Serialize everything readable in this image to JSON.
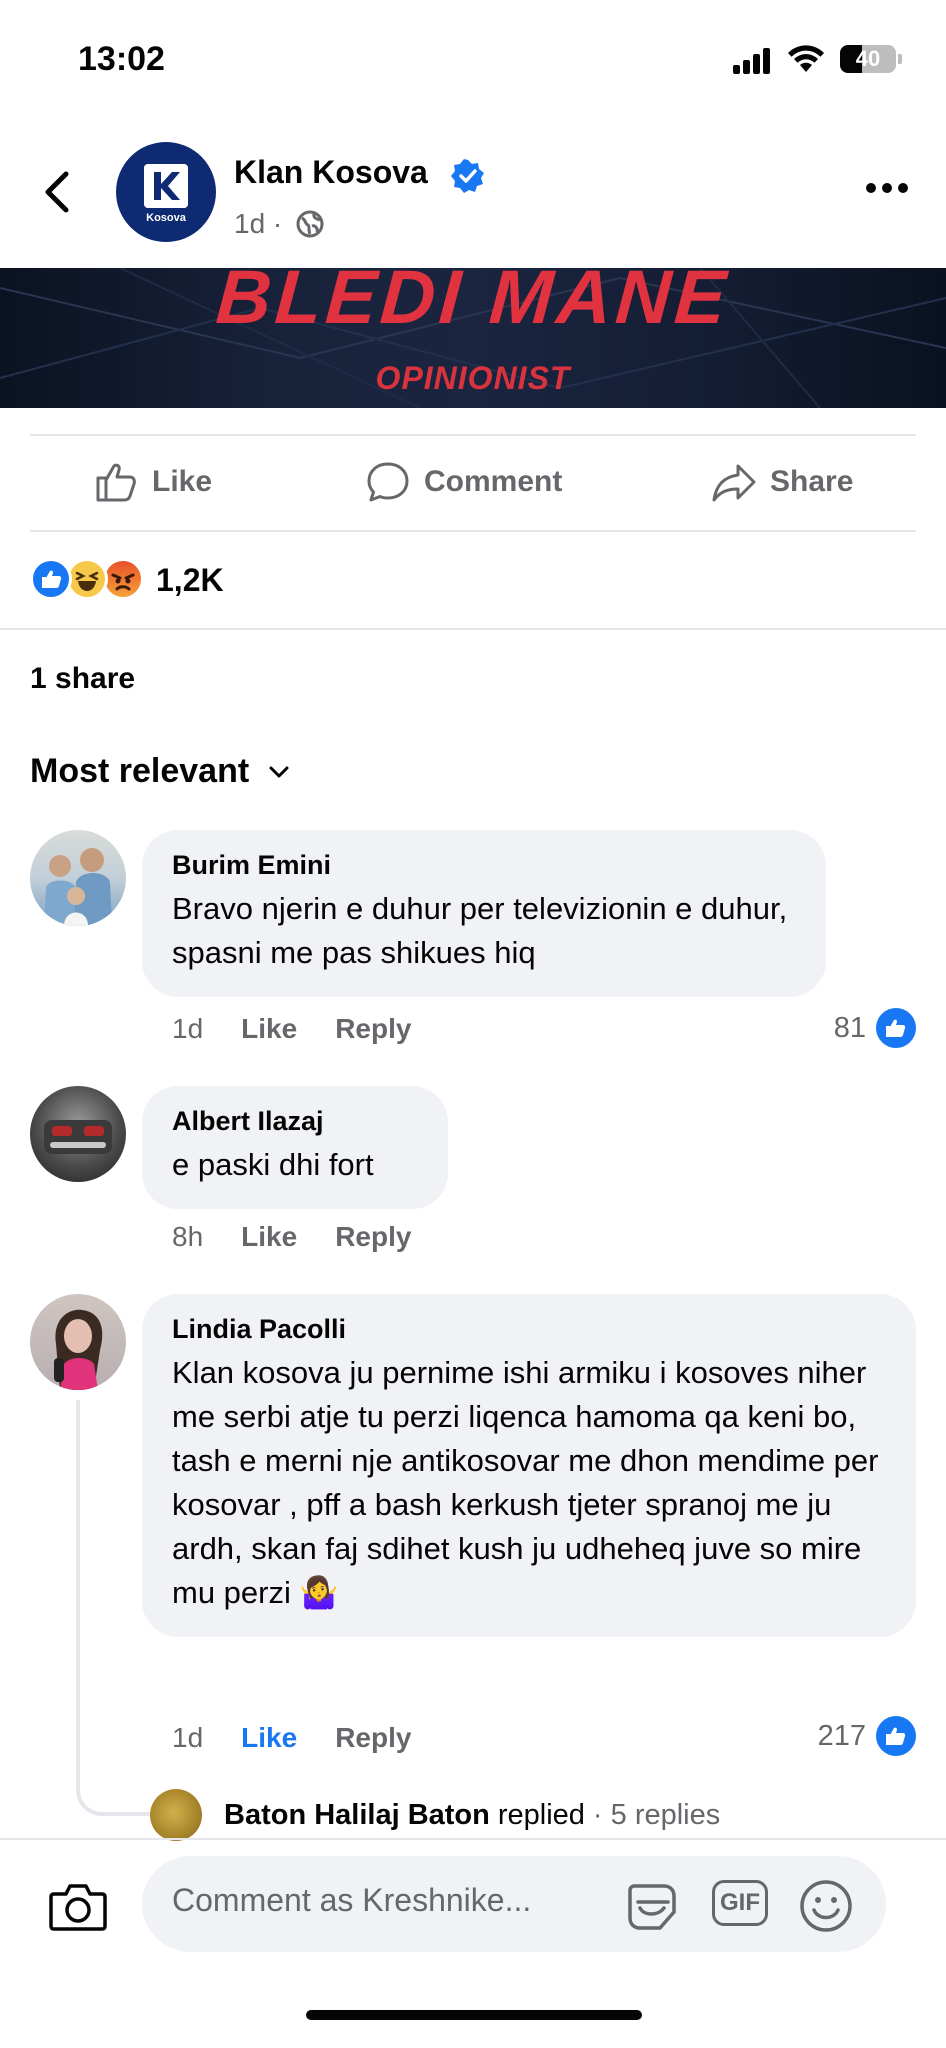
{
  "status_bar": {
    "time": "13:02",
    "battery": "40",
    "battery_level": 0.4
  },
  "post": {
    "page_name": "Klan Kosova",
    "avatar_label": "Kosova",
    "meta": "1d ·",
    "banner": {
      "title": "BLEDI MANE",
      "subtitle": "OPINIONIST"
    }
  },
  "actions": {
    "like": "Like",
    "comment": "Comment",
    "share": "Share"
  },
  "reactions": {
    "icons": [
      "like-icon",
      "haha-icon",
      "angry-icon"
    ],
    "count": "1,2K"
  },
  "shares": "1 share",
  "sort_label": "Most relevant",
  "comments": [
    {
      "author": "Burim Emini",
      "text": "Bravo njerin e duhur per televizionin e duhur, spasni me pas shikues hiq",
      "time": "1d",
      "like": "Like",
      "reply": "Reply",
      "likes": "81"
    },
    {
      "author": "Albert Ilazaj",
      "text": "e paski dhi fort",
      "time": "8h",
      "like": "Like",
      "reply": "Reply",
      "likes": ""
    },
    {
      "author": "Lindia Pacolli",
      "text": "Klan kosova ju pernime ishi armiku i kosoves niher me serbi atje tu perzi liqenca hamoma qa keni bo, tash e merni nje antikosovar me dhon mendime per kosovar , pff a bash kerkush tjeter spranoj me ju ardh, skan faj sdihet kush ju udheheq juve so mire mu perzi 🤷‍♀️",
      "time": "1d",
      "like": "Like",
      "reply": "Reply",
      "likes": "217"
    }
  ],
  "reply_preview": {
    "name": "Baton Halilaj Baton",
    "verb": "replied",
    "count": "· 5 replies"
  },
  "composer": {
    "placeholder": "Comment as Kreshnike...",
    "gif_label": "GIF"
  },
  "colors": {
    "accent": "#1877f2",
    "muted": "#65676b",
    "bubble": "#f0f2f5",
    "banner_red": "#e1323f"
  }
}
